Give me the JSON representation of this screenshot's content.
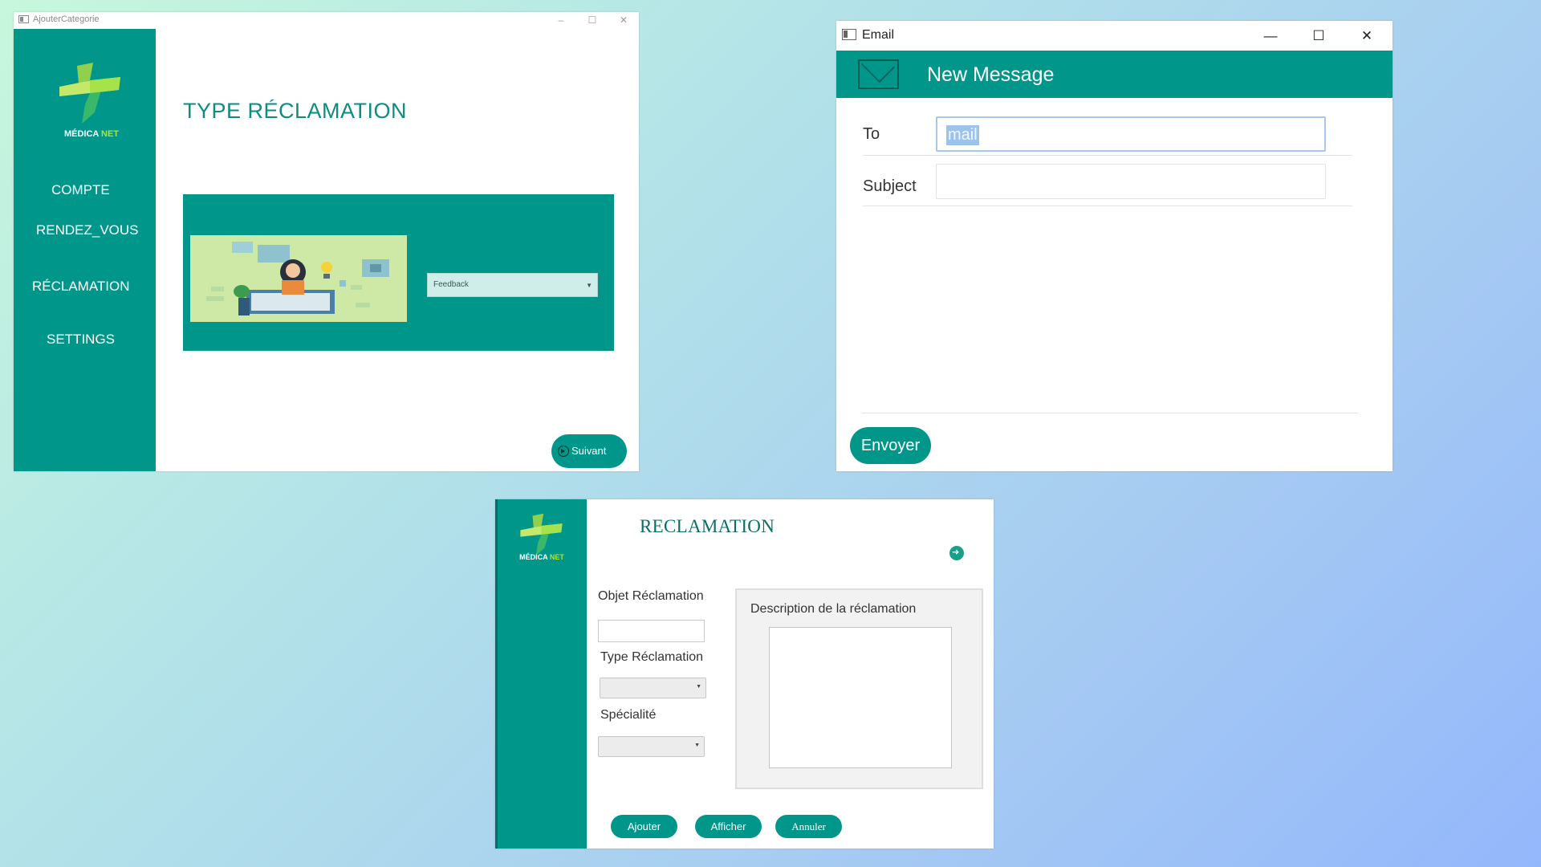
{
  "colors": {
    "teal": "#01968a",
    "accent_green": "#a6e34a",
    "heading_teal": "#0d8c80"
  },
  "window1": {
    "title": "AjouterCategorie",
    "controls": {
      "minimize": "–",
      "maximize": "☐",
      "close": "✕"
    },
    "logo": {
      "brand": "MÉDICA",
      "brand_suffix": "NET"
    },
    "nav": [
      "COMPTE",
      "RENDEZ_VOUS",
      "RÉCLAMATION",
      "SETTINGS"
    ],
    "heading": "TYPE RÉCLAMATION",
    "dropdown_value": "Feedback",
    "next_button": "Suivant"
  },
  "window2": {
    "title": "Email",
    "controls": {
      "minimize": "—",
      "maximize": "☐",
      "close": "✕"
    },
    "header_title": "New Message",
    "to_label": "To",
    "to_value": "mail",
    "subject_label": "Subject",
    "subject_value": "",
    "send_button": "Envoyer"
  },
  "window3": {
    "logo": {
      "brand": "MÉDICA",
      "brand_suffix": "NET"
    },
    "title": "RECLAMATION",
    "objet_label": "Objet Réclamation",
    "objet_value": "",
    "type_label": "Type Réclamation",
    "specialite_label": "Spécialité",
    "description_label": "Description de la réclamation",
    "buttons": {
      "add": "Ajouter",
      "show": "Afficher",
      "cancel": "Annuler"
    }
  }
}
